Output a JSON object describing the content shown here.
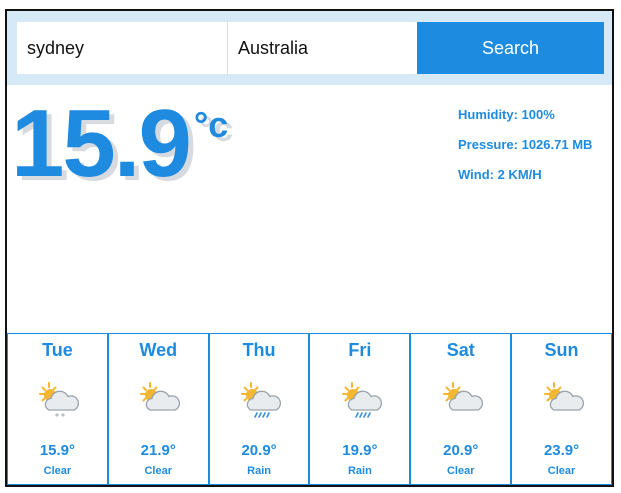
{
  "search": {
    "city_value": "sydney",
    "country_value": "Australia",
    "button_label": "Search"
  },
  "current": {
    "temperature": "15.9",
    "unit": "°c",
    "humidity": "Humidity: 100%",
    "pressure": "Pressure: 1026.71 MB",
    "wind": "Wind: 2 KM/H"
  },
  "forecast": [
    {
      "day": "Tue",
      "temp": "15.9°",
      "desc": "Clear",
      "icon": "snow-cloud-sun-icon"
    },
    {
      "day": "Wed",
      "temp": "21.9°",
      "desc": "Clear",
      "icon": "partly-cloudy-icon"
    },
    {
      "day": "Thu",
      "temp": "20.9°",
      "desc": "Rain",
      "icon": "rain-cloud-sun-icon"
    },
    {
      "day": "Fri",
      "temp": "19.9°",
      "desc": "Rain",
      "icon": "rain-cloud-sun-icon"
    },
    {
      "day": "Sat",
      "temp": "20.9°",
      "desc": "Clear",
      "icon": "partly-cloudy-icon"
    },
    {
      "day": "Sun",
      "temp": "23.9°",
      "desc": "Clear",
      "icon": "partly-cloudy-icon"
    }
  ],
  "colors": {
    "accent": "#1f8be0",
    "button": "#1d8ce0",
    "search_bar_bg": "#d6e9f7",
    "sun": "#f5b631",
    "cloud": "#e8ecef",
    "rain": "#3a8fd8"
  }
}
